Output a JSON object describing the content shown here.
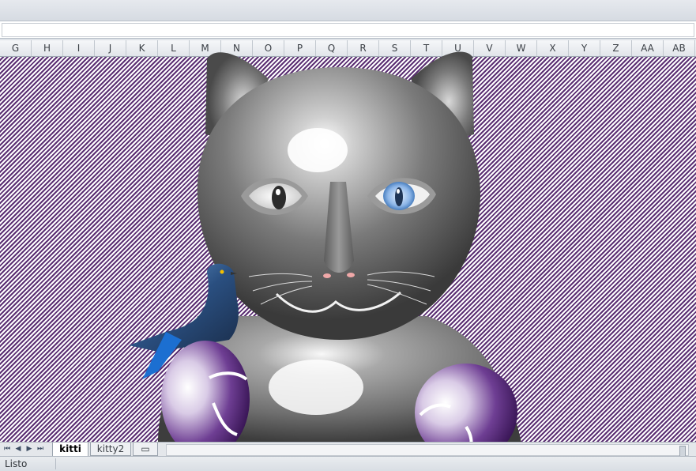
{
  "spreadsheet": {
    "columns": [
      "G",
      "H",
      "I",
      "J",
      "K",
      "L",
      "M",
      "N",
      "O",
      "P",
      "Q",
      "R",
      "S",
      "T",
      "U",
      "V",
      "W",
      "X",
      "Y",
      "Z",
      "AA",
      "AB"
    ],
    "sheet_tabs": [
      "kitti",
      "kitty2"
    ],
    "active_tab": "kitti"
  },
  "status": {
    "text": "Listo"
  },
  "navigation_icons": [
    "first-sheet-icon",
    "prev-sheet-icon",
    "next-sheet-icon",
    "last-sheet-icon",
    "insert-sheet-icon"
  ],
  "colors": {
    "pattern_dark": "#5b2f73",
    "pattern_light": "#ffffff",
    "cat_gray": "#8a8a8a",
    "ball_purple": "#4b1f6e",
    "bird_blue": "#2a7fd1"
  }
}
